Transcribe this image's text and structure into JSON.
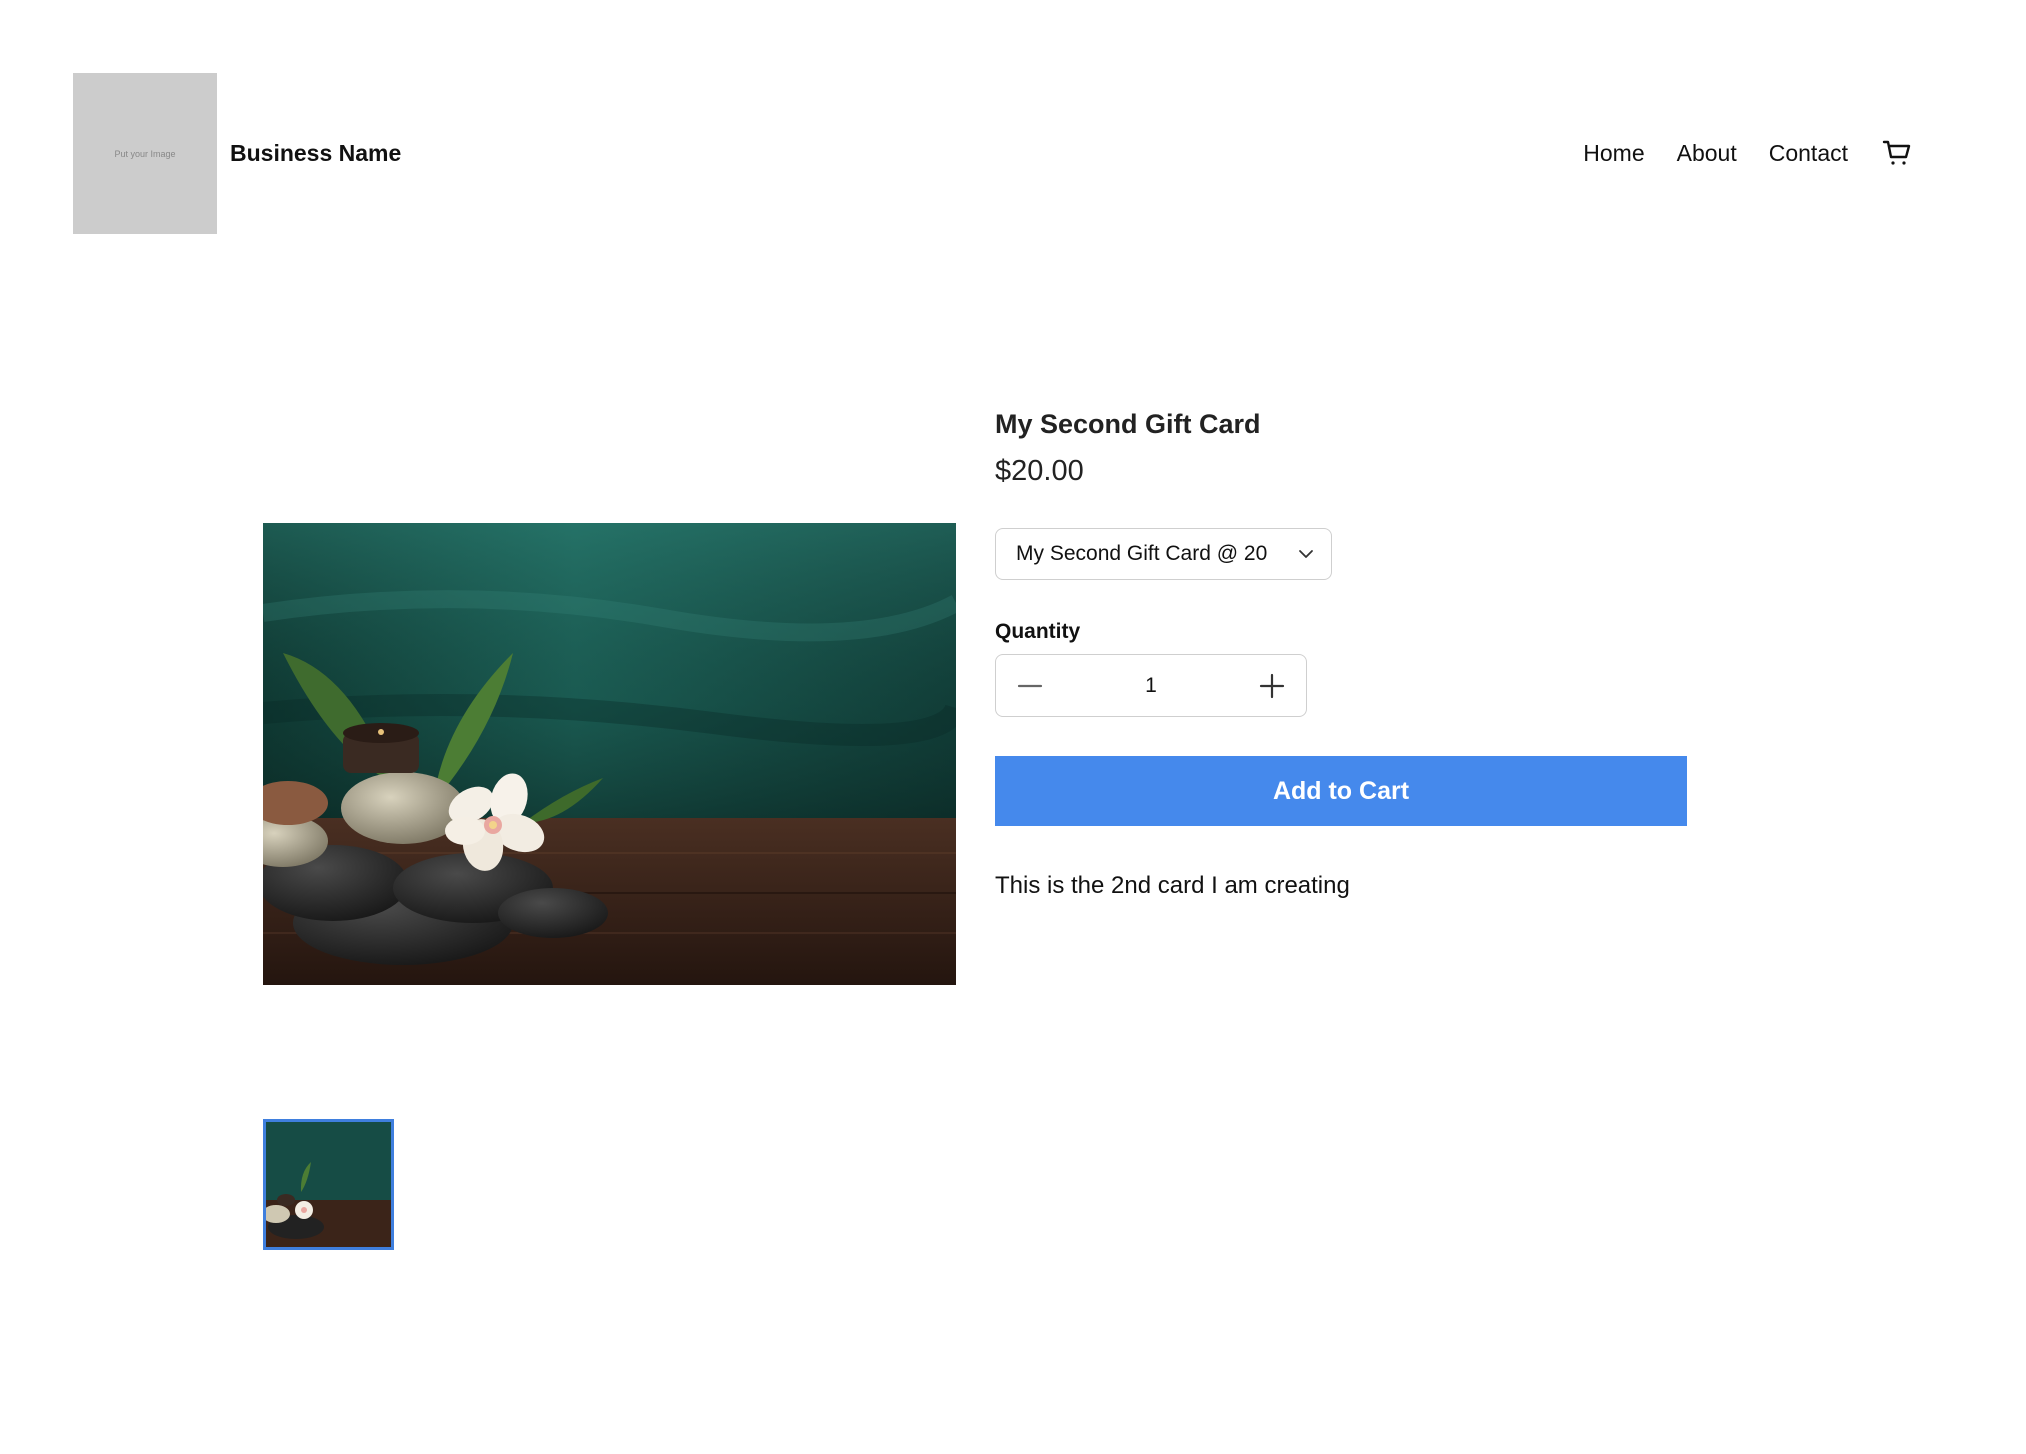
{
  "header": {
    "logo_placeholder": "Put your Image",
    "business_name": "Business Name",
    "nav": [
      {
        "label": "Home"
      },
      {
        "label": "About"
      },
      {
        "label": "Contact"
      }
    ],
    "cart_icon": "shopping-cart-icon"
  },
  "product": {
    "title": "My Second Gift Card",
    "price": "$20.00",
    "variant_selected": "My Second Gift Card @ 20",
    "quantity_label": "Quantity",
    "quantity_value": "1",
    "add_to_cart_label": "Add to Cart",
    "description": "This is the 2nd card I am creating",
    "main_image": "spa-stones-orchid-image",
    "thumbnail": "spa-stones-orchid-thumbnail"
  },
  "colors": {
    "accent": "#4589ec",
    "thumbnail_border": "#3f7fde",
    "logo_placeholder": "#cccccc"
  }
}
